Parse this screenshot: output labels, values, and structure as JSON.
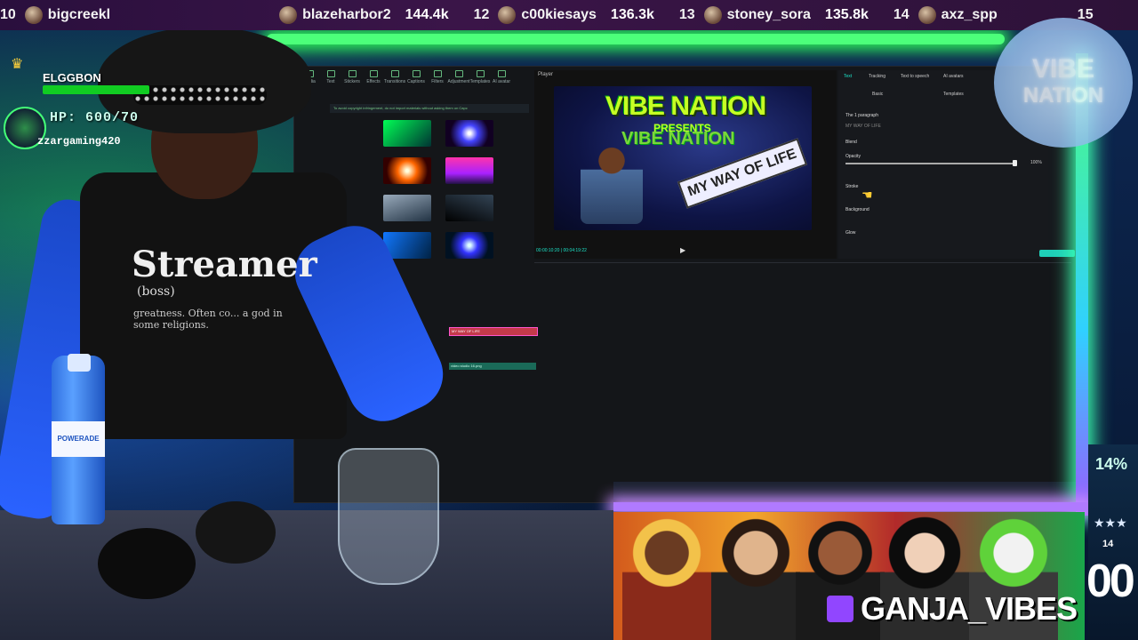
{
  "ticker": {
    "entries": [
      {
        "rank": "10",
        "name": "bigcreekl",
        "score": ""
      },
      {
        "rank": "",
        "name": "blazeharbor2",
        "score": "144.4k"
      },
      {
        "rank": "12",
        "name": "c00kiesays",
        "score": "136.3k"
      },
      {
        "rank": "13",
        "name": "stoney_sora",
        "score": "135.8k"
      },
      {
        "rank": "14",
        "name": "axz_spp",
        "score": ""
      },
      {
        "rank": "15",
        "name": "",
        "score": ""
      }
    ]
  },
  "player_card": {
    "name": "ELGGBON",
    "hp": "HP: 600/70",
    "username": "zzargaming420"
  },
  "editor": {
    "menu_tabs": [
      "Media",
      "Text",
      "Stickers",
      "Effects",
      "Transitions",
      "Captions",
      "Filters",
      "Adjustment",
      "Templates",
      "AI avatar"
    ],
    "notice": "To avoid copyright infringement, do not import materials without asking them on Capc",
    "player_label": "Player",
    "preview": {
      "line1": "VIBE NATION",
      "line2": "PRESENTS",
      "line3": "VIBE NATION",
      "banner": "MY WAY OF LIFE"
    },
    "timecode": "00:00:10:20 | 00:04:19:22",
    "props_tabs": [
      "Text",
      "Tracking",
      "Text to speech",
      "AI avatars"
    ],
    "props_sub": [
      "Basic",
      "Templates"
    ],
    "props_rows": [
      "The 1 paragraph",
      "MY WAY OF LIFE",
      "Blend",
      "Opacity",
      "Stroke",
      "Background",
      "Glow"
    ],
    "opacity_value": "100%",
    "clips": [
      "MY WAY OF LIFE",
      "video studio 16.png"
    ]
  },
  "logo": {
    "line1": "VIBE",
    "line2": "NATION"
  },
  "shirt": {
    "title": "Streamer",
    "word": "(boss)",
    "definition": "greatness. Often co... a god in some religions."
  },
  "bottle_label": "POWERADE",
  "brand": {
    "text": "GANJA_VIBES"
  },
  "side_stats": {
    "percent": "14%",
    "stars": "★★★",
    "small": "14",
    "big": "00"
  },
  "colors": {
    "neon_green": "#4cff7a",
    "neon_purple": "#b07aff",
    "twitch": "#9146ff",
    "accent_teal": "#1ce3c8"
  }
}
